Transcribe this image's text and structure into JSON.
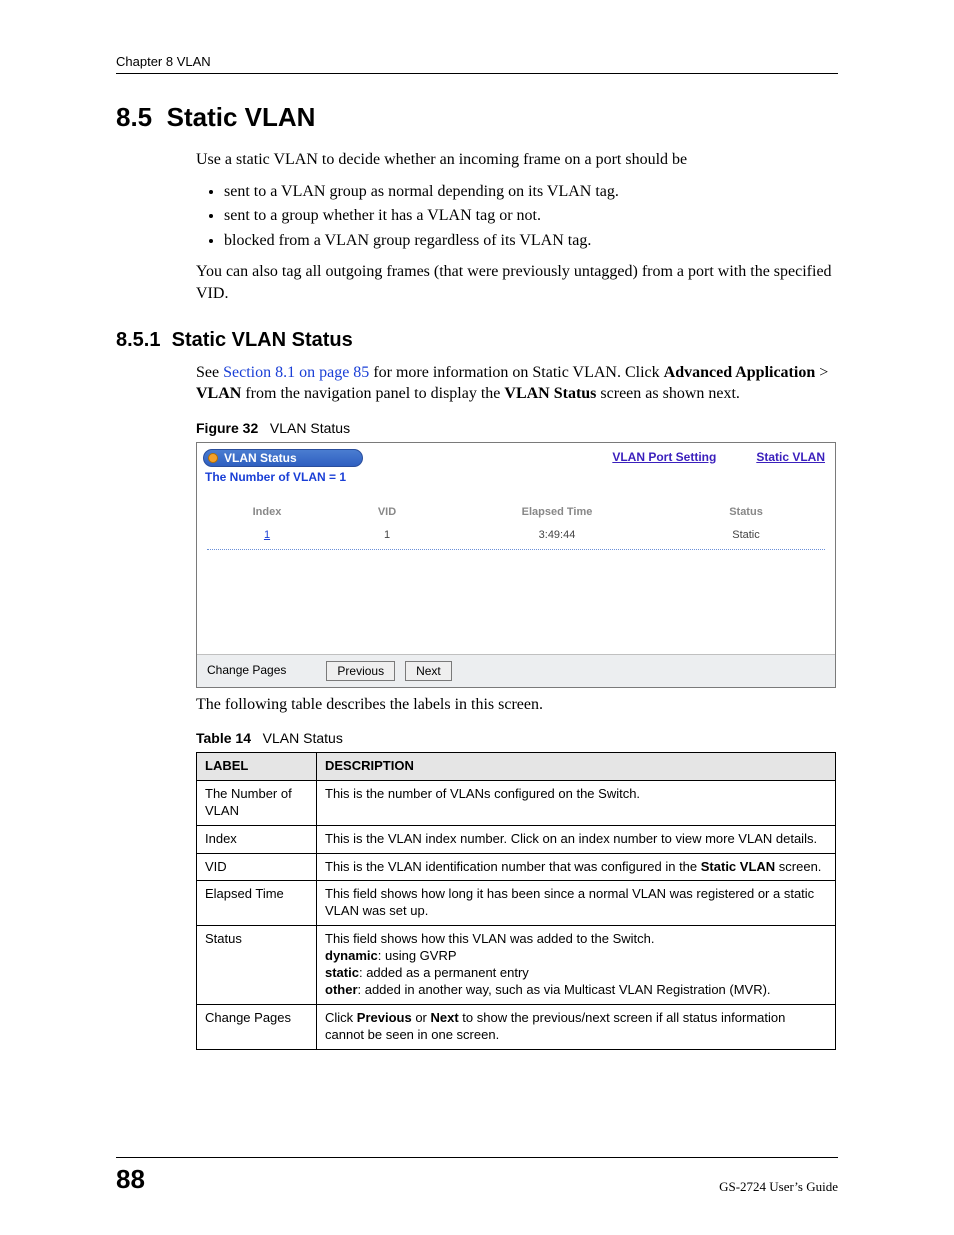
{
  "header": {
    "running": "Chapter 8 VLAN"
  },
  "section": {
    "number": "8.5",
    "title": "Static VLAN"
  },
  "intro": "Use a static VLAN to decide whether an incoming frame on a port should be",
  "bullets": [
    "sent to a VLAN group as normal depending on its VLAN tag.",
    "sent to a group whether it has a VLAN tag or not.",
    "blocked from a VLAN group regardless of its VLAN tag."
  ],
  "intro2": "You can also tag all outgoing frames (that were previously untagged) from a port with the specified VID.",
  "subsection": {
    "number": "8.5.1",
    "title": "Static VLAN Status"
  },
  "subpara": {
    "pre": "See ",
    "xref": "Section 8.1 on page 85",
    "mid1": " for more information on Static VLAN. Click ",
    "b1": "Advanced Application",
    "gt": " > ",
    "b2": "VLAN",
    "mid2": " from the navigation panel to display the ",
    "b3": "VLAN Status",
    "post": " screen as shown next."
  },
  "figure": {
    "cap_num": "Figure 32",
    "cap_title": "VLAN Status",
    "tab_title": "VLAN Status",
    "count_label": "The Number of VLAN = 1",
    "links": {
      "port": "VLAN Port Setting",
      "static": "Static VLAN"
    },
    "columns": {
      "c1": "Index",
      "c2": "VID",
      "c3": "Elapsed Time",
      "c4": "Status"
    },
    "row": {
      "index": "1",
      "vid": "1",
      "elapsed": "3:49:44",
      "status": "Static"
    },
    "footer": {
      "label": "Change Pages",
      "prev": "Previous",
      "next": "Next"
    }
  },
  "after_fig": "The following table describes the labels in this screen.",
  "table": {
    "cap_num": "Table 14",
    "cap_title": "VLAN Status",
    "head": {
      "label": "LABEL",
      "desc": "DESCRIPTION"
    },
    "rows": [
      {
        "label": "The Number of VLAN",
        "desc": [
          {
            "t": "This is the number of VLANs configured on the Switch."
          }
        ]
      },
      {
        "label": "Index",
        "desc": [
          {
            "t": "This is the VLAN index number. Click on an index number to view more VLAN details."
          }
        ]
      },
      {
        "label": "VID",
        "desc": [
          {
            "t": "This is the VLAN identification number that was configured in the "
          },
          {
            "b": "Static VLAN"
          },
          {
            "t": " screen."
          }
        ]
      },
      {
        "label": "Elapsed Time",
        "desc": [
          {
            "t": "This field shows how long it has been since a normal VLAN was registered or a static VLAN was set up."
          }
        ]
      },
      {
        "label": "Status",
        "desc": [
          {
            "t": "This field shows how this VLAN was added to the Switch."
          },
          {
            "br": true
          },
          {
            "b": "dynamic"
          },
          {
            "t": ": using GVRP"
          },
          {
            "br": true
          },
          {
            "b": "static"
          },
          {
            "t": ": added as a permanent entry"
          },
          {
            "br": true
          },
          {
            "b": "other"
          },
          {
            "t": ": added in another way, such as via Multicast VLAN Registration (MVR)."
          }
        ]
      },
      {
        "label": "Change Pages",
        "desc": [
          {
            "t": "Click "
          },
          {
            "b": "Previous"
          },
          {
            "t": " or "
          },
          {
            "b": "Next"
          },
          {
            "t": " to show the previous/next screen if all status information cannot be seen in one screen."
          }
        ]
      }
    ]
  },
  "footer": {
    "page": "88",
    "guide": "GS-2724 User’s Guide"
  }
}
